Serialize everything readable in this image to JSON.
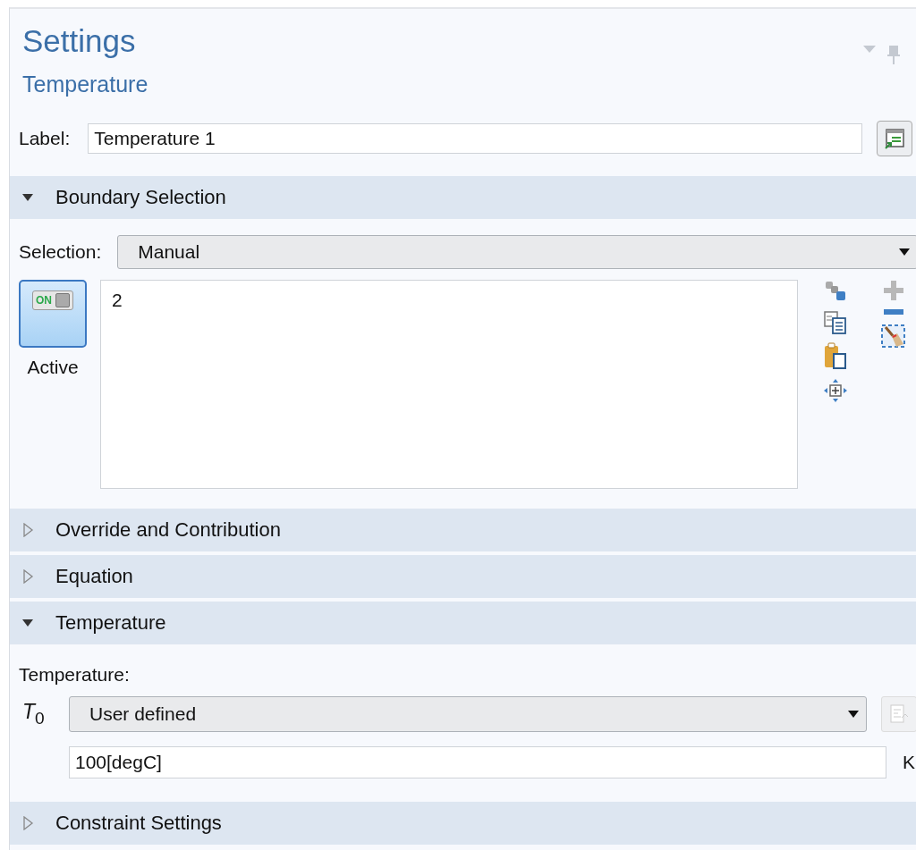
{
  "panel": {
    "title": "Settings",
    "subtitle": "Temperature"
  },
  "label": {
    "caption": "Label:",
    "value": "Temperature 1"
  },
  "sections": [
    {
      "kind": "selection",
      "title": "Boundary Selection",
      "expanded": true,
      "selection_caption": "Selection:",
      "selection_value": "Manual",
      "toggle_text": "ON",
      "active": true,
      "active_label": "Active",
      "entities": [
        "2"
      ]
    },
    {
      "title": "Override and Contribution",
      "expanded": false
    },
    {
      "title": "Equation",
      "expanded": false
    },
    {
      "kind": "temperature",
      "title": "Temperature",
      "expanded": true,
      "caption": "Temperature:",
      "symbol": "*T*$_{0}$",
      "mode": "User defined",
      "value": "100[degC]",
      "unit": "K"
    },
    {
      "title": "Constraint Settings",
      "expanded": false
    }
  ]
}
